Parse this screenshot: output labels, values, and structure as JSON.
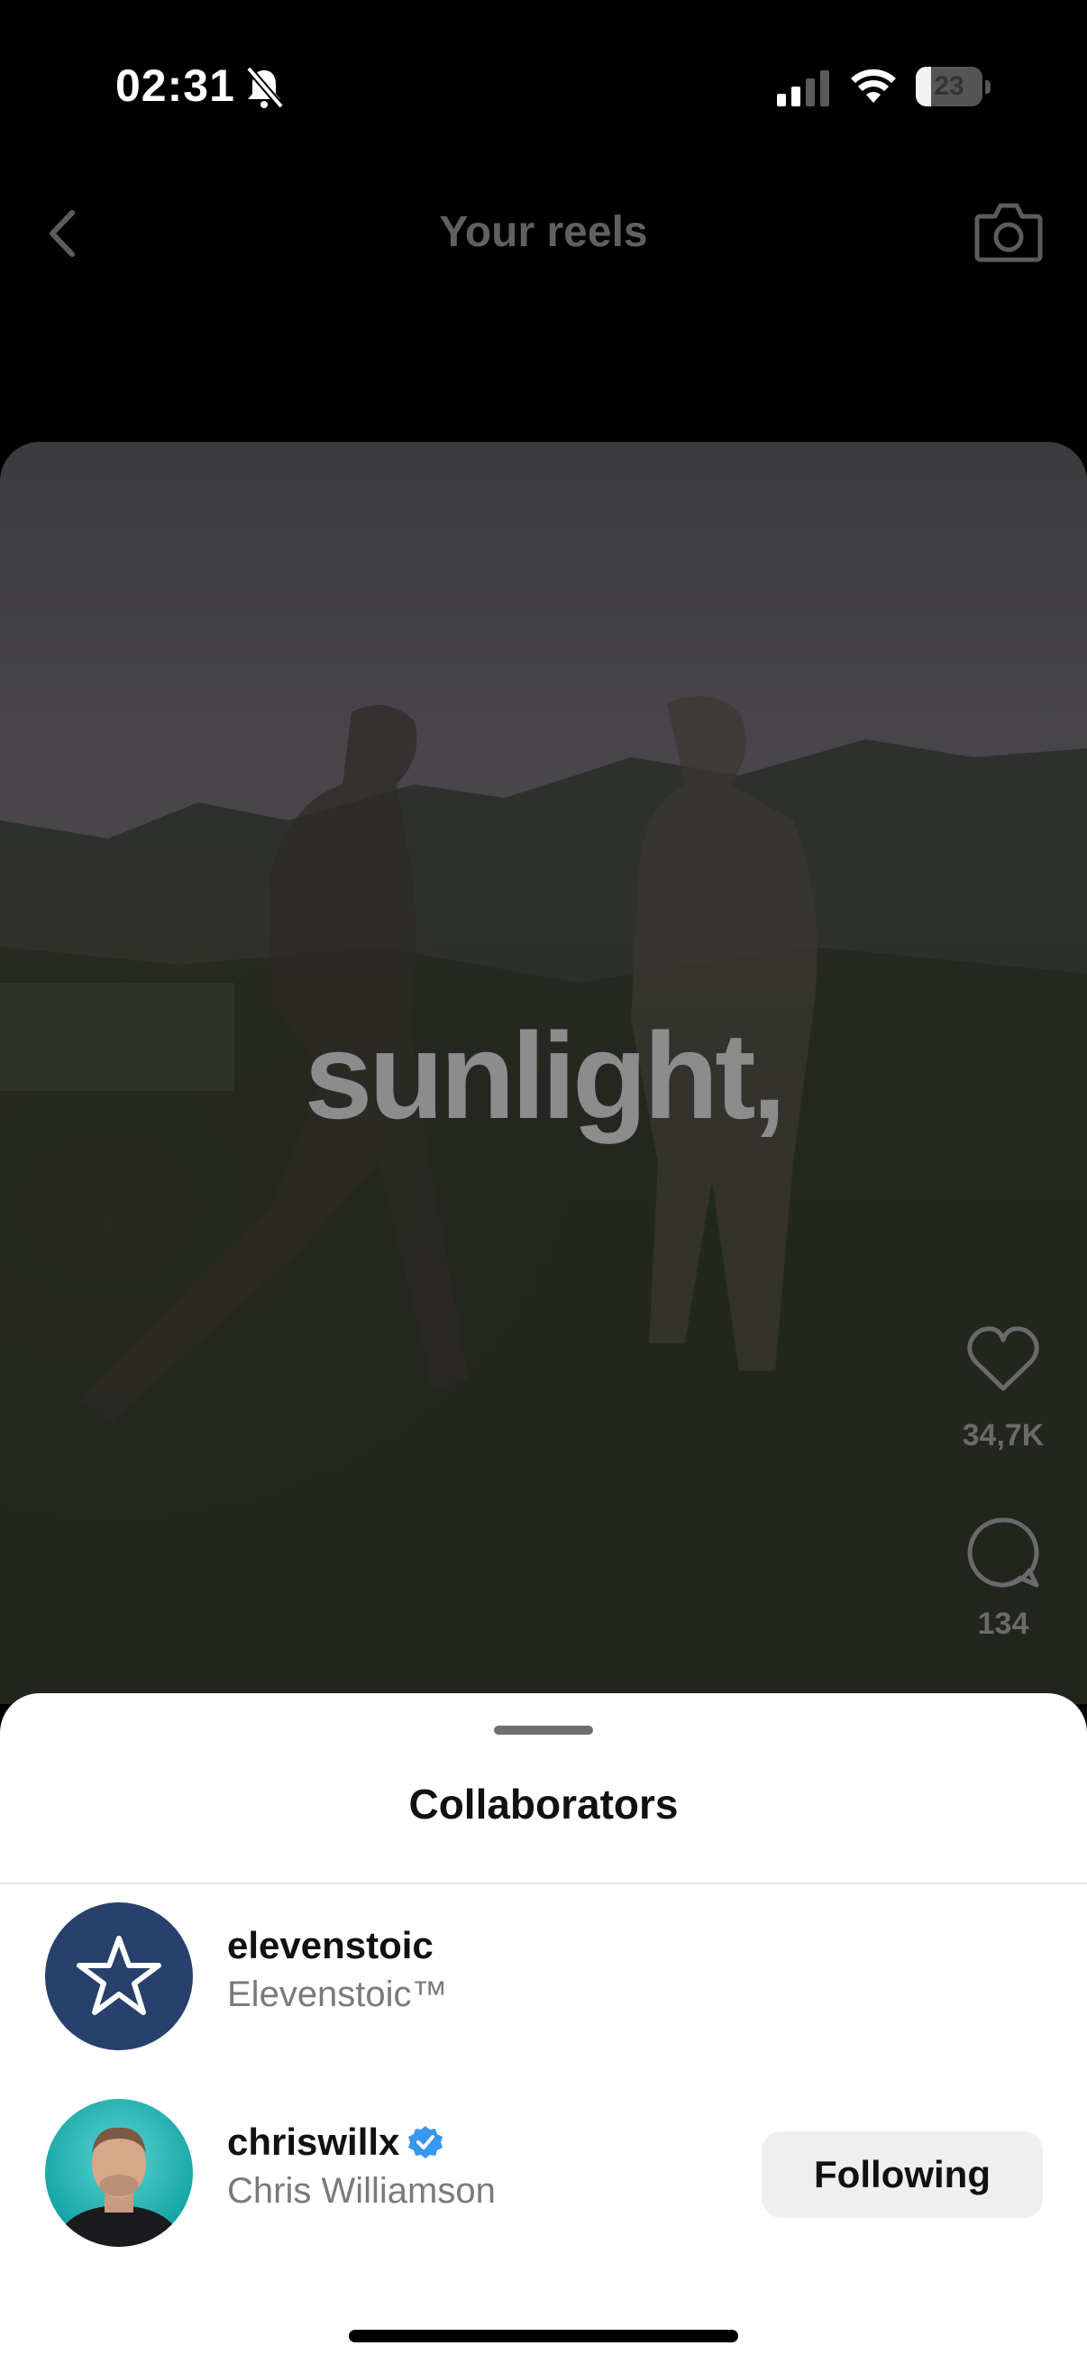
{
  "status_bar": {
    "time": "02:31",
    "battery_level": "23",
    "battery_fraction": 0.23
  },
  "header": {
    "title": "Your reels"
  },
  "reel": {
    "caption": "sunlight,",
    "likes": "34,7K",
    "comments": "134"
  },
  "sheet": {
    "title": "Collaborators",
    "collaborators": [
      {
        "username": "elevenstoic",
        "full_name": "Elevenstoic™",
        "verified": false,
        "avatar_icon": "star-icon"
      },
      {
        "username": "chriswillx",
        "full_name": "Chris Williamson",
        "verified": true,
        "button_label": "Following"
      }
    ]
  },
  "colors": {
    "verified_badge": "#3897f0",
    "star_avatar_bg": "#27406c",
    "sheet_bg": "#ffffff"
  }
}
